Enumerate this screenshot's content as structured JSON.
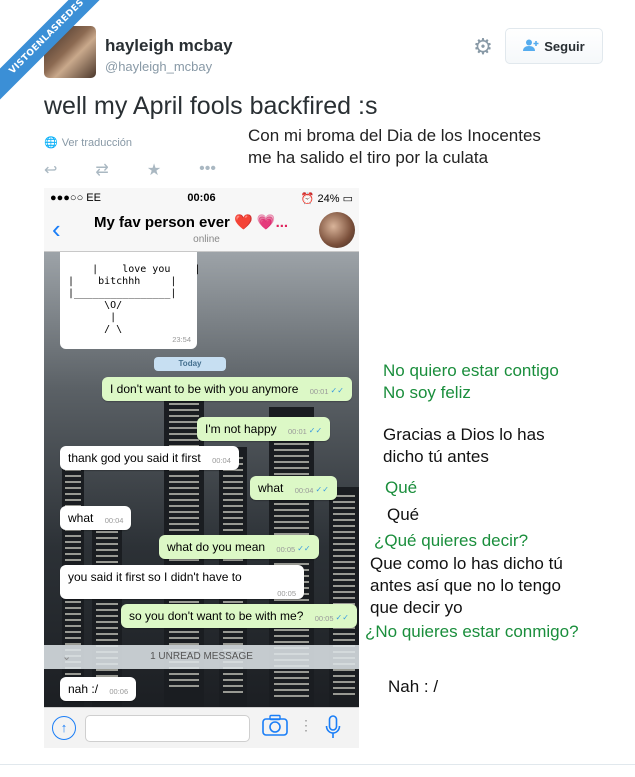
{
  "watermark": "VISTOENLASREDES",
  "tweet": {
    "name": "hayleigh mcbay",
    "handle": "@hayleigh_mcbay",
    "follow_label": "Seguir",
    "text": "well my April fools backfired :s",
    "translate_label": "Ver traducción",
    "caption_line1": "Con mi broma del Dia de los Inocentes",
    "caption_line2": "me ha salido el tiro por la culata"
  },
  "phone": {
    "carrier": "●●●○○ EE",
    "time": "00:06",
    "battery": "24%",
    "chat_title": "My fav person ever",
    "chat_title_suffix": "❤️ 💗...",
    "chat_status": "online",
    "ascii_art": "|    love you    |\n|    bitchhh     |\n|________________|\n      \\O/\n       |\n      / \\",
    "ascii_time": "23:54",
    "day_label": "Today",
    "unread_label": "1 UNREAD MESSAGE",
    "messages": [
      {
        "text": "I don't want to be with you anymore",
        "time": "00:01"
      },
      {
        "text": "I'm not happy",
        "time": "00:01"
      },
      {
        "text": "thank god you said it first",
        "time": "00:04"
      },
      {
        "text": "what",
        "time": "00:04"
      },
      {
        "text": "what",
        "time": "00:04"
      },
      {
        "text": "what do you mean",
        "time": "00:05"
      },
      {
        "text": "you said it first so I didn't have to",
        "time": "00:05"
      },
      {
        "text": "so you don't want to be with me?",
        "time": "00:05"
      },
      {
        "text": "nah :/",
        "time": "00:06"
      }
    ]
  },
  "translations": [
    "No quiero estar contigo",
    "No soy feliz",
    "Gracias a Dios lo has",
    "dicho tú antes",
    "Qué",
    "Qué",
    "¿Qué quieres decir?",
    "Que como lo has dicho tú",
    "antes así que no lo tengo",
    "que decir yo",
    "¿No quieres estar conmigo?",
    "Nah : /"
  ],
  "colors": {
    "outgoing_bubble": "#dcf8c6",
    "incoming_bubble": "#ffffff",
    "translation_green": "#1a8e3c",
    "ios_blue": "#1a7ef7",
    "watermark_blue": "#3b8fd6"
  }
}
